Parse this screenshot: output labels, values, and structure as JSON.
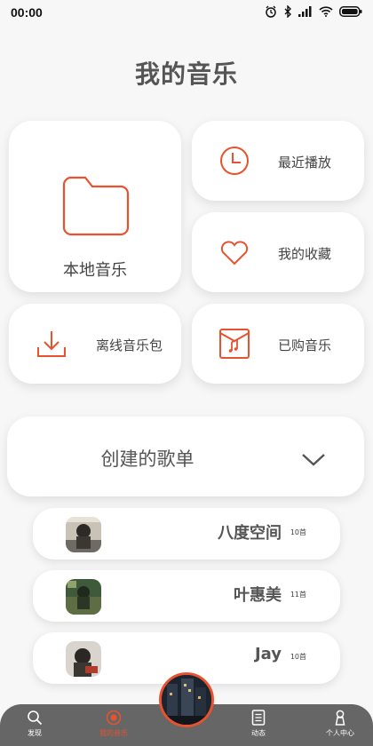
{
  "status": {
    "time": "00:00"
  },
  "page": {
    "title": "我的音乐"
  },
  "cards": {
    "local": "本地音乐",
    "recent": "最近播放",
    "favorites": "我的收藏",
    "offline": "离线音乐包",
    "purchased": "已购音乐"
  },
  "playlists": {
    "title": "创建的歌单",
    "items": [
      {
        "name": "八度空间",
        "count": "10首"
      },
      {
        "name": "叶惠美",
        "count": "11首"
      },
      {
        "name": "Jay",
        "count": "10首"
      }
    ]
  },
  "nav": {
    "items": [
      {
        "label": "发现",
        "icon": "search-icon"
      },
      {
        "label": "我的音乐",
        "icon": "music-record-icon",
        "active": true
      },
      {
        "label": "动态",
        "icon": "feed-icon"
      },
      {
        "label": "个人中心",
        "icon": "person-icon"
      }
    ]
  },
  "colors": {
    "accent": "#e8522e",
    "nav_bg": "#666666",
    "background": "#f7f7f7"
  }
}
